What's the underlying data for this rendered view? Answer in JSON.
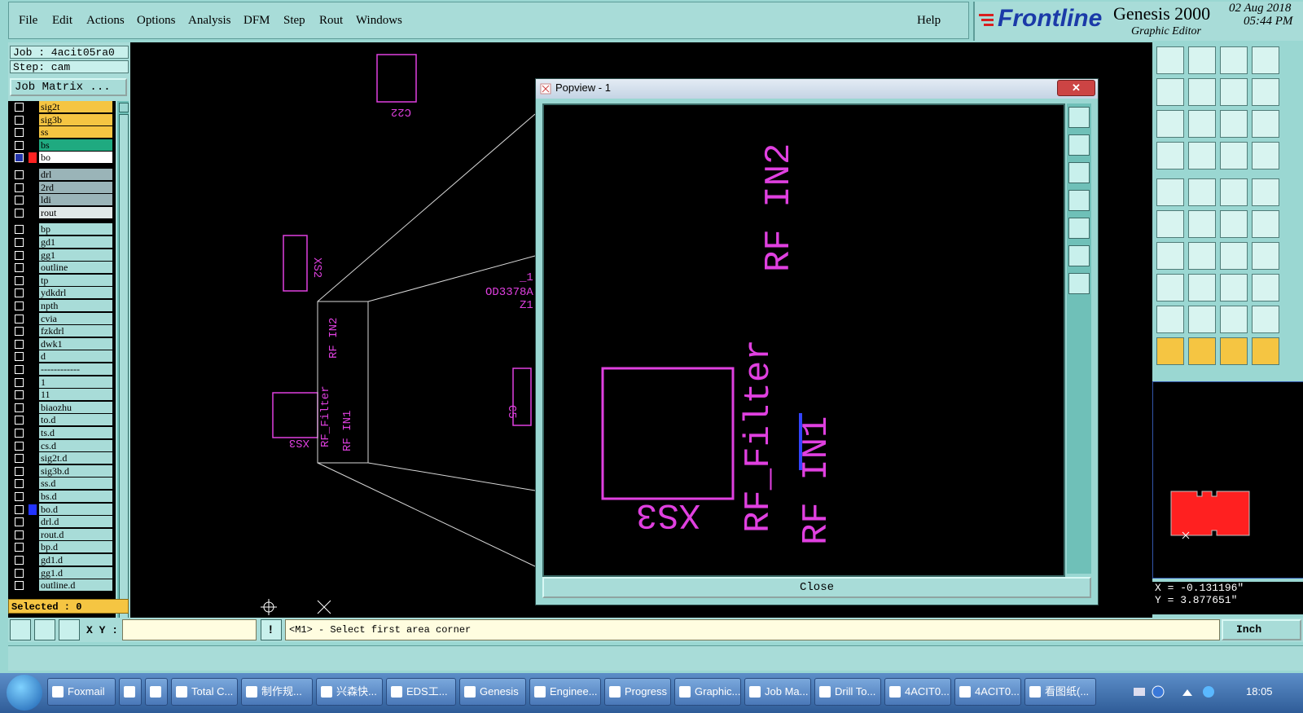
{
  "menu": [
    "File",
    "Edit",
    "Actions",
    "Options",
    "Analysis",
    "DFM",
    "Step",
    "Rout",
    "Windows"
  ],
  "help_label": "Help",
  "brand": {
    "logo": "Frontline",
    "product": "Genesis 2000",
    "subtitle": "Graphic Editor",
    "date": "02 Aug 2018",
    "time": "05:44 PM"
  },
  "job": {
    "job_line": "Job : 4acit05ra0",
    "step_line": "Step: cam",
    "matrix_button": "Job Matrix ..."
  },
  "layers": [
    {
      "name": "sig2t",
      "color": "#f5c542"
    },
    {
      "name": "sig3b",
      "color": "#f5c542"
    },
    {
      "name": "ss",
      "color": "#f5c542"
    },
    {
      "name": "bs",
      "color": "#1faa80"
    },
    {
      "name": "bo",
      "color": "#ffffff",
      "swatch": "#ff2222",
      "active": true
    },
    {
      "name": "drl",
      "color": "#9ab4b8",
      "gap": true
    },
    {
      "name": "2rd",
      "color": "#9ab4b8"
    },
    {
      "name": "ldi",
      "color": "#9ab4b8"
    },
    {
      "name": "rout",
      "color": "#e0e8e8"
    },
    {
      "name": "bp",
      "color": "#a8dcd8",
      "gap": true
    },
    {
      "name": "gd1",
      "color": "#a8dcd8"
    },
    {
      "name": "gg1",
      "color": "#a8dcd8"
    },
    {
      "name": "outline",
      "color": "#a8dcd8"
    },
    {
      "name": "tp",
      "color": "#a8dcd8"
    },
    {
      "name": "ydkdrl",
      "color": "#a8dcd8"
    },
    {
      "name": "npth",
      "color": "#a8dcd8"
    },
    {
      "name": "cvia",
      "color": "#a8dcd8"
    },
    {
      "name": "fzkdrl",
      "color": "#a8dcd8"
    },
    {
      "name": "dwk1",
      "color": "#a8dcd8"
    },
    {
      "name": "d",
      "color": "#a8dcd8"
    },
    {
      "name": "------------",
      "color": "#a8dcd8"
    },
    {
      "name": "1",
      "color": "#a8dcd8"
    },
    {
      "name": "11",
      "color": "#a8dcd8"
    },
    {
      "name": "biaozhu",
      "color": "#a8dcd8"
    },
    {
      "name": "to.d",
      "color": "#a8dcd8"
    },
    {
      "name": "ts.d",
      "color": "#a8dcd8"
    },
    {
      "name": "cs.d",
      "color": "#a8dcd8"
    },
    {
      "name": "sig2t.d",
      "color": "#a8dcd8"
    },
    {
      "name": "sig3b.d",
      "color": "#a8dcd8"
    },
    {
      "name": "ss.d",
      "color": "#a8dcd8"
    },
    {
      "name": "bs.d",
      "color": "#a8dcd8"
    },
    {
      "name": "bo.d",
      "color": "#a8dcd8",
      "swatch": "#2233ff"
    },
    {
      "name": "drl.d",
      "color": "#a8dcd8"
    },
    {
      "name": "rout.d",
      "color": "#a8dcd8"
    },
    {
      "name": "bp.d",
      "color": "#a8dcd8"
    },
    {
      "name": "gd1.d",
      "color": "#a8dcd8"
    },
    {
      "name": "gg1.d",
      "color": "#a8dcd8"
    },
    {
      "name": "outline.d",
      "color": "#a8dcd8"
    }
  ],
  "selected_label": "Selected : 0",
  "popview": {
    "title": "Popview - 1",
    "close_label": "Close",
    "text_in2": "RF IN2",
    "text_filter": "RF_Filter",
    "text_in1": "RF IN1",
    "text_xs3": "XS3"
  },
  "canvas_text": {
    "in2": "RF IN2",
    "filter": "RF_Filter",
    "in1": "RF IN1",
    "xs3": "XS3",
    "c22": "C22",
    "xs2": "XS2",
    "part1": "_1",
    "part2": "OD3378A",
    "part3": "Z1",
    "c5": "C5"
  },
  "coords": {
    "x": "X = -0.131196\"",
    "y": "Y = 3.877651\""
  },
  "command": {
    "xy_label": "X Y :",
    "prompt": "<M1> - Select first area corner",
    "units": "Inch"
  },
  "taskbar": {
    "items": [
      "Foxmail",
      "",
      "",
      "Total C...",
      "制作规...",
      "兴森快...",
      "EDS工...",
      "Genesis",
      "Enginee...",
      "Progress",
      "Graphic...",
      "Job Ma...",
      "Drill To...",
      "4ACIT0...",
      "4ACIT0...",
      "看图纸(..."
    ],
    "clock": "18:05"
  }
}
